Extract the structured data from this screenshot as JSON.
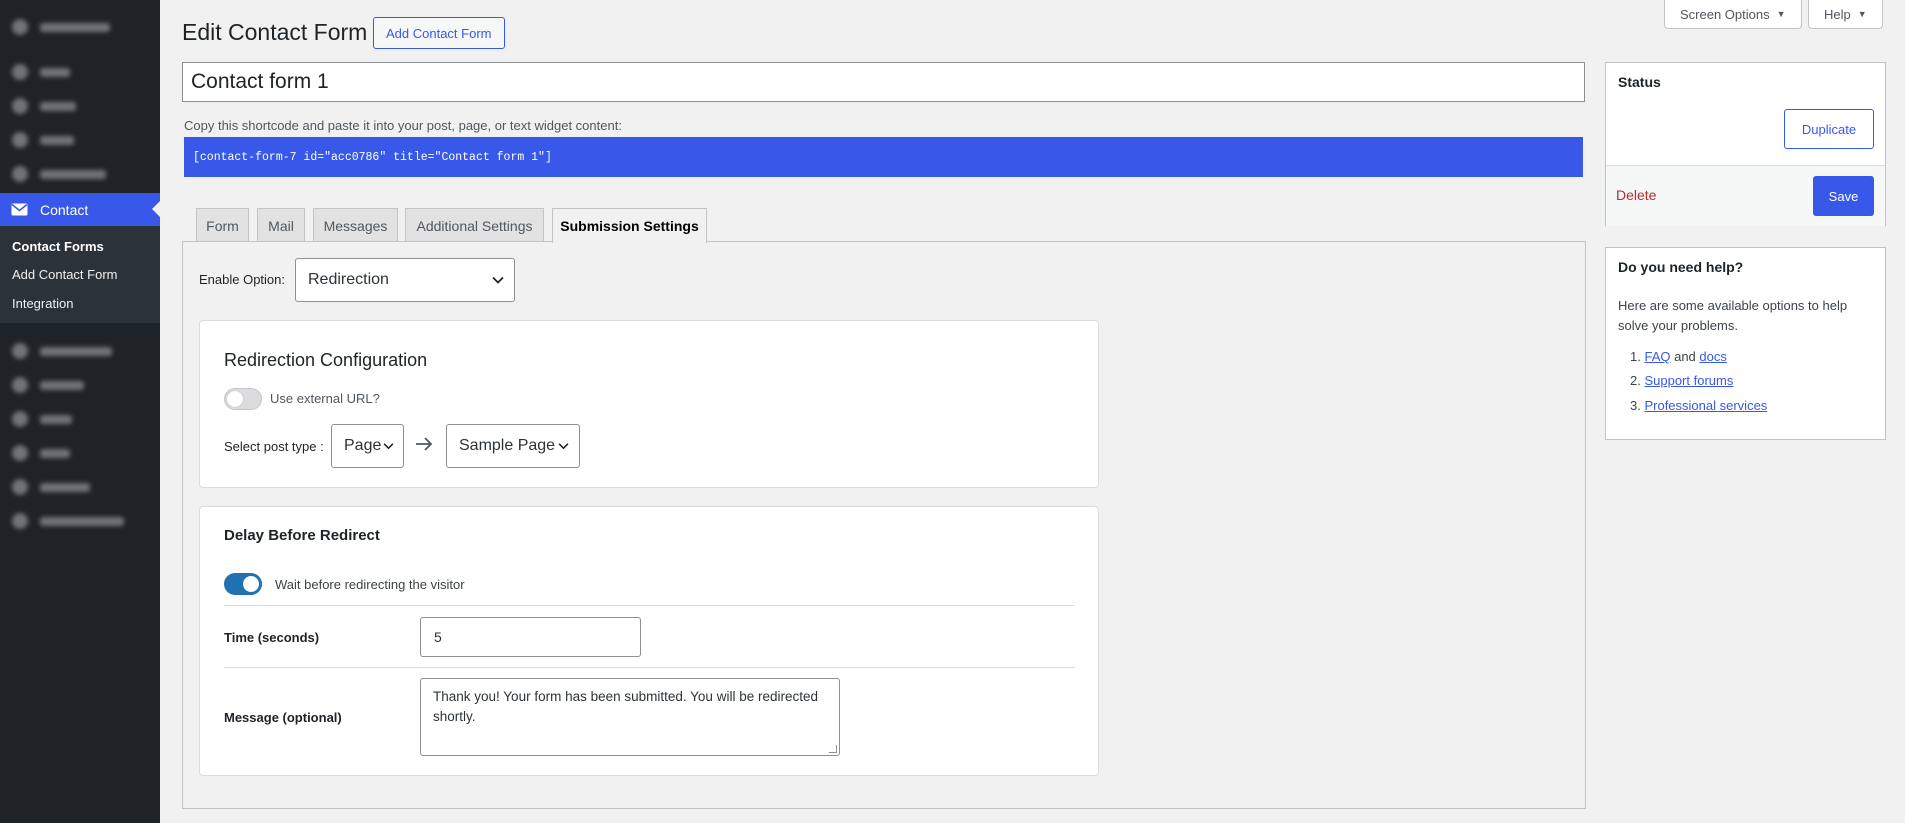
{
  "topbar": {
    "screen_options_label": "Screen Options",
    "help_label": "Help"
  },
  "sidebar": {
    "contact_label": "Contact",
    "submenu": [
      {
        "label": "Contact Forms"
      },
      {
        "label": "Add Contact Form"
      },
      {
        "label": "Integration"
      }
    ]
  },
  "header": {
    "title": "Edit Contact Form",
    "add_button": "Add Contact Form"
  },
  "form": {
    "title_value": "Contact form 1",
    "shortcode_desc": "Copy this shortcode and paste it into your post, page, or text widget content:",
    "shortcode": "[contact-form-7 id=\"acc0786\" title=\"Contact form 1\"]"
  },
  "tabs": [
    {
      "label": "Form"
    },
    {
      "label": "Mail"
    },
    {
      "label": "Messages"
    },
    {
      "label": "Additional Settings"
    },
    {
      "label": "Submission Settings",
      "active": true
    }
  ],
  "submission": {
    "enable_label": "Enable Option:",
    "enable_value": "Redirection",
    "redirection": {
      "title": "Redirection Configuration",
      "external_url_label": "Use external URL?",
      "external_url_on": false,
      "post_type_label": "Select post type :",
      "post_type_value": "Page",
      "page_value": "Sample Page"
    },
    "delay": {
      "title": "Delay Before Redirect",
      "wait_label": "Wait before redirecting the visitor",
      "wait_on": true,
      "time_label": "Time (seconds)",
      "time_value": "5",
      "message_label": "Message (optional)",
      "message_value": "Thank you! Your form has been submitted. You will be redirected shortly."
    }
  },
  "status": {
    "title": "Status",
    "duplicate": "Duplicate",
    "delete": "Delete",
    "save": "Save"
  },
  "help": {
    "title": "Do you need help?",
    "desc": "Here are some available options to help solve your problems.",
    "items": [
      {
        "num": "1.",
        "link1": "FAQ",
        "mid": " and ",
        "link2": "docs"
      },
      {
        "num": "2.",
        "link1": "Support forums"
      },
      {
        "num": "3.",
        "link1": "Professional services"
      }
    ]
  },
  "colors": {
    "accent": "#3858e9",
    "sidebar_bg": "#1d2327",
    "toggle_on": "#2271b1",
    "delete": "#b32d2e"
  }
}
